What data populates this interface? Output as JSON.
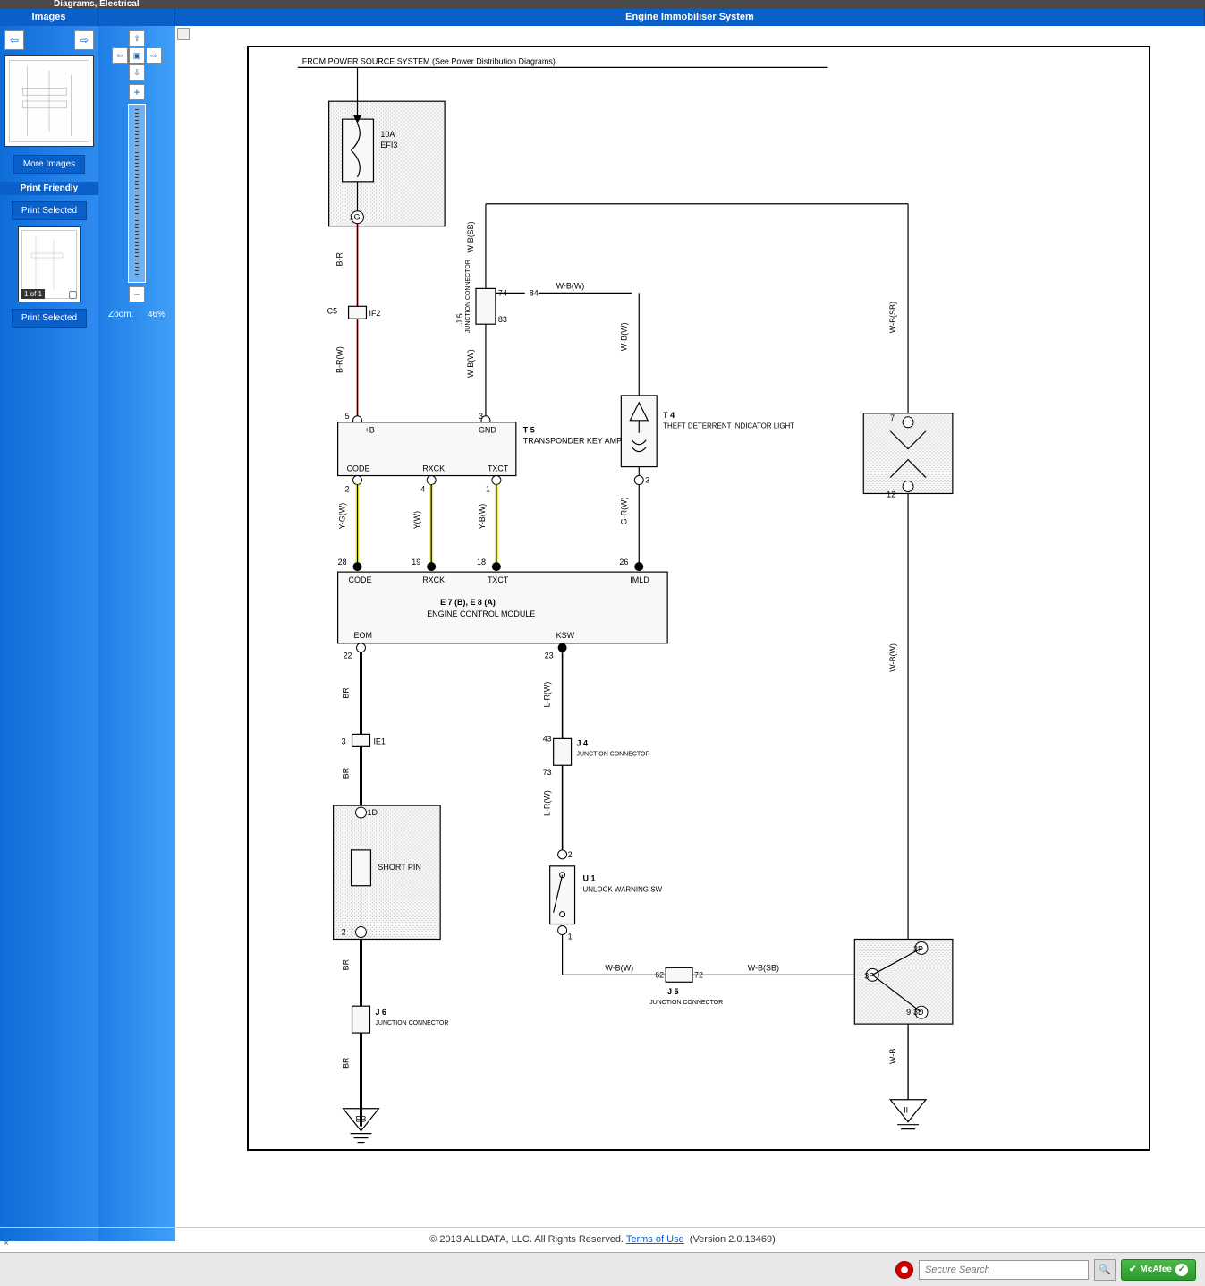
{
  "titlebar": "Diagrams, Electrical",
  "headers": {
    "images": "Images",
    "main": "Engine Immobiliser System"
  },
  "sidebar": {
    "more_images": "More Images",
    "print_friendly": "Print Friendly",
    "print_selected": "Print Selected",
    "page_badge": "1 of 1"
  },
  "zoom": {
    "label": "Zoom:",
    "value": "46%"
  },
  "footer": {
    "copyright": "© 2013 ALLDATA, LLC. All Rights Reserved.",
    "terms": "Terms of Use",
    "version": "(Version 2.0.13469)"
  },
  "search": {
    "placeholder": "Secure Search"
  },
  "mcafee": "McAfee",
  "diagram": {
    "top_note": "FROM POWER SOURCE SYSTEM (See Power Distribution Diagrams)",
    "fuse": {
      "rating": "10A",
      "name": "EFI3"
    },
    "wires": {
      "br": "B-R",
      "brw": "B-R(W)",
      "ygw": "Y-G(W)",
      "yw": "Y(W)",
      "ybw": "Y-B(W)",
      "wbw": "W-B(W)",
      "wbsb": "W-B(SB)",
      "wb": "W-B",
      "lrw": "L-R(W)",
      "grw": "G-R(W)",
      "br_plain": "BR"
    },
    "components": {
      "t5": {
        "id": "T 5",
        "name": "TRANSPONDER KEY AMPLIFIER",
        "pins": {
          "pb": "+B",
          "gnd": "GND",
          "code": "CODE",
          "rxck": "RXCK",
          "txct": "TXCT"
        }
      },
      "t4": {
        "id": "T 4",
        "name": "THEFT DETERRENT INDICATOR LIGHT"
      },
      "ecm": {
        "line1": "E 7 (B),   E 8 (A)",
        "line2": "ENGINE CONTROL MODULE",
        "pins": {
          "code": "CODE",
          "rxck": "RXCK",
          "txct": "TXCT",
          "imld": "IMLD",
          "eom": "EOM",
          "ksw": "KSW"
        }
      },
      "j5a": {
        "id": "J 5",
        "name": "JUNCTION CONNECTOR"
      },
      "j4": {
        "id": "J 4",
        "name": "JUNCTION CONNECTOR"
      },
      "j5b": {
        "id": "J 5",
        "name": "JUNCTION CONNECTOR"
      },
      "j6": {
        "id": "J 6",
        "name": "JUNCTION CONNECTOR"
      },
      "u1": {
        "id": "U 1",
        "name": "UNLOCK WARNING SW"
      },
      "short_pin": "SHORT PIN",
      "c5": "C5",
      "if2": "IF2",
      "ie1": "IE1",
      "eb": "EB",
      "ii": "II"
    },
    "pins": {
      "p1g": "1G",
      "p74": "74",
      "p83": "83",
      "p84": "84",
      "p5": "5",
      "p3": "3",
      "p2": "2",
      "p4": "4",
      "p1": "1",
      "p7": "7",
      "p12": "12",
      "p28": "28",
      "p19": "19",
      "p18": "18",
      "p26": "26",
      "p22": "22",
      "p23": "23",
      "p43": "43",
      "p73": "73",
      "p62": "62",
      "p72": "72",
      "p9": "9",
      "p1d": "1D",
      "p2sp": "2",
      "p3p": "3P",
      "p3d": "3D"
    }
  }
}
